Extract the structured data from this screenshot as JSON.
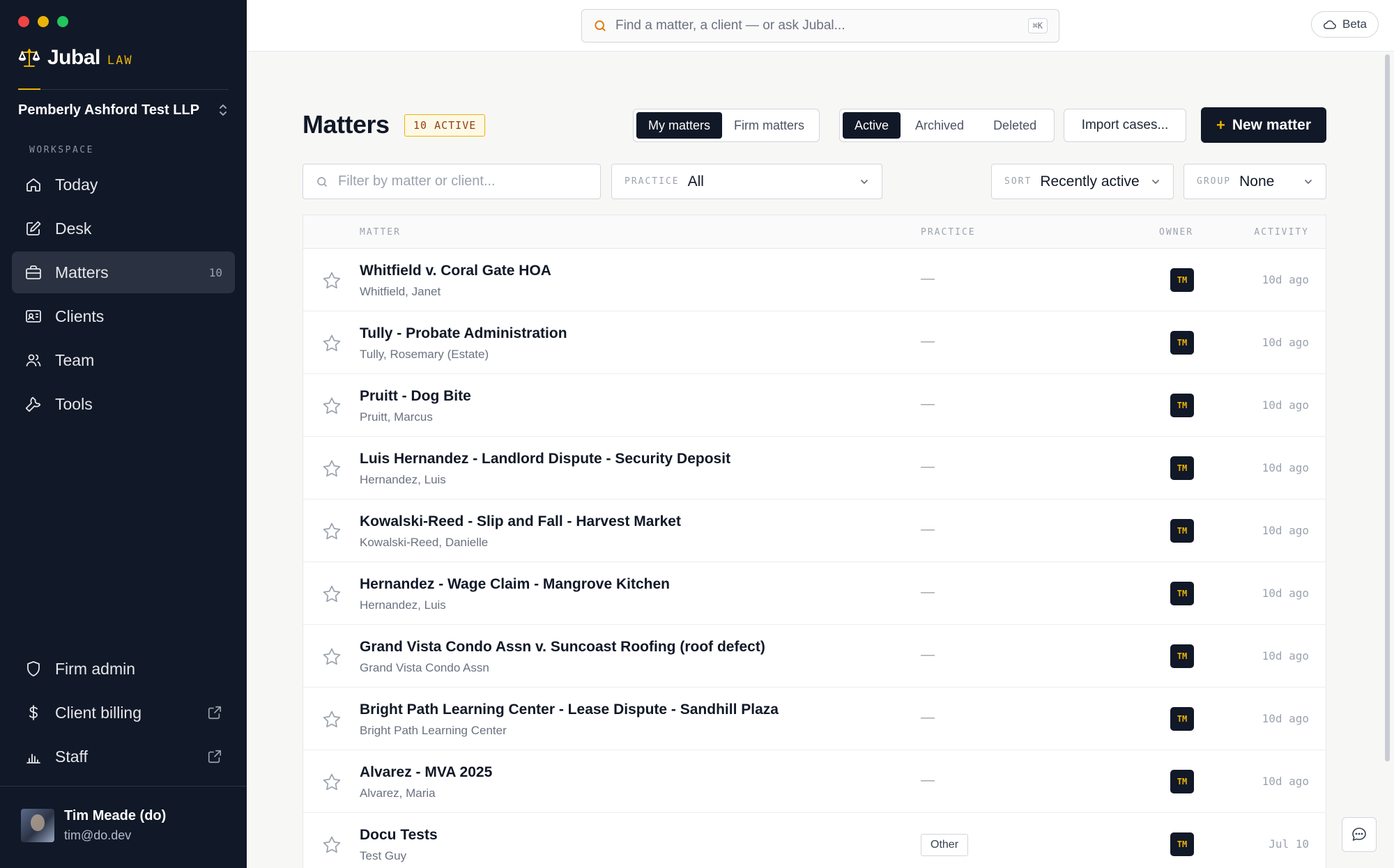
{
  "sidebar": {
    "brand": {
      "name": "Jubal",
      "suffix": "LAW"
    },
    "firm": "Pemberly Ashford Test LLP",
    "section_label": "WORKSPACE",
    "items": [
      {
        "label": "Today",
        "icon": "home-icon"
      },
      {
        "label": "Desk",
        "icon": "edit-icon"
      },
      {
        "label": "Matters",
        "icon": "briefcase-icon",
        "count": "10",
        "active": true
      },
      {
        "label": "Clients",
        "icon": "id-card-icon"
      },
      {
        "label": "Team",
        "icon": "users-icon"
      },
      {
        "label": "Tools",
        "icon": "wrench-icon"
      }
    ],
    "bottom_items": [
      {
        "label": "Firm admin",
        "icon": "shield-icon"
      },
      {
        "label": "Client billing",
        "icon": "dollar-icon",
        "external": true
      },
      {
        "label": "Staff",
        "icon": "bar-chart-icon",
        "external": true
      }
    ],
    "user": {
      "name": "Tim Meade (do)",
      "email": "tim@do.dev"
    }
  },
  "topbar": {
    "search_placeholder": "Find a matter, a client — or ask Jubal...",
    "shortcut": "⌘K",
    "beta_label": "Beta"
  },
  "main": {
    "title": "Matters",
    "badge": "10 ACTIVE",
    "scope_tabs": [
      "My matters",
      "Firm matters"
    ],
    "status_tabs": [
      "Active",
      "Archived",
      "Deleted"
    ],
    "import_label": "Import cases...",
    "new_label": "New matter",
    "filter_placeholder": "Filter by matter or client...",
    "practice": {
      "label": "PRACTICE",
      "value": "All"
    },
    "sort": {
      "label": "SORT",
      "value": "Recently active"
    },
    "group": {
      "label": "GROUP",
      "value": "None"
    }
  },
  "table": {
    "columns": [
      "MATTER",
      "PRACTICE",
      "OWNER",
      "ACTIVITY"
    ],
    "rows": [
      {
        "title": "Whitfield v. Coral Gate HOA",
        "client": "Whitfield, Janet",
        "practice": "—",
        "owner": "TM",
        "activity": "10d ago"
      },
      {
        "title": "Tully - Probate Administration",
        "client": "Tully, Rosemary (Estate)",
        "practice": "—",
        "owner": "TM",
        "activity": "10d ago"
      },
      {
        "title": "Pruitt - Dog Bite",
        "client": "Pruitt, Marcus",
        "practice": "—",
        "owner": "TM",
        "activity": "10d ago"
      },
      {
        "title": "Luis Hernandez - Landlord Dispute - Security Deposit",
        "client": "Hernandez, Luis",
        "practice": "—",
        "owner": "TM",
        "activity": "10d ago"
      },
      {
        "title": "Kowalski-Reed - Slip and Fall - Harvest Market",
        "client": "Kowalski-Reed, Danielle",
        "practice": "—",
        "owner": "TM",
        "activity": "10d ago"
      },
      {
        "title": "Hernandez - Wage Claim - Mangrove Kitchen",
        "client": "Hernandez, Luis",
        "practice": "—",
        "owner": "TM",
        "activity": "10d ago"
      },
      {
        "title": "Grand Vista Condo Assn v. Suncoast Roofing (roof defect)",
        "client": "Grand Vista Condo Assn",
        "practice": "—",
        "owner": "TM",
        "activity": "10d ago"
      },
      {
        "title": "Bright Path Learning Center - Lease Dispute - Sandhill Plaza",
        "client": "Bright Path Learning Center",
        "practice": "—",
        "owner": "TM",
        "activity": "10d ago"
      },
      {
        "title": "Alvarez - MVA 2025",
        "client": "Alvarez, Maria",
        "practice": "—",
        "owner": "TM",
        "activity": "10d ago"
      },
      {
        "title": "Docu Tests",
        "client": "Test Guy",
        "practice": "Other",
        "owner": "TM",
        "activity": "Jul 10",
        "tagged": true
      }
    ]
  },
  "colors": {
    "accent": "#eab308",
    "sidebar_bg": "#111827",
    "active_nav": "#2a3140"
  }
}
